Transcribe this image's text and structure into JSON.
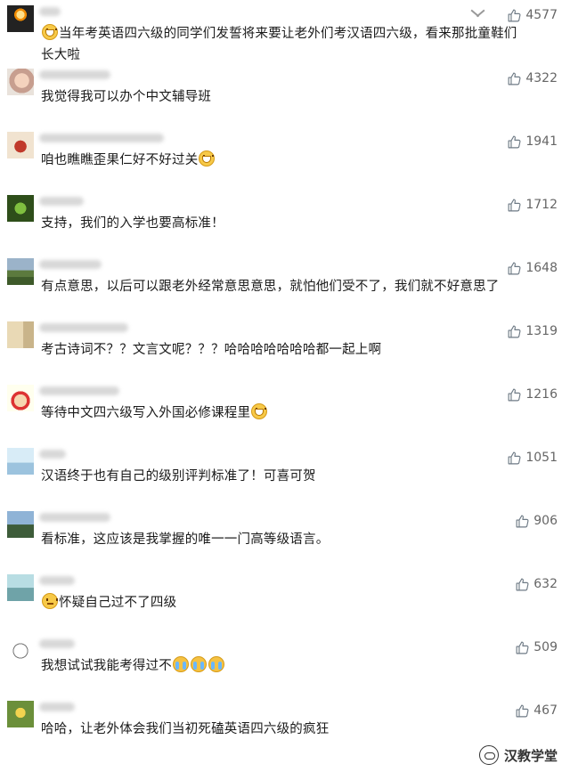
{
  "comments": [
    {
      "avatar": "candle-avatar",
      "likes": "4577",
      "pre_emoji": "grin",
      "text": "当年考英语四六级的同学们发誓将来要让老外们考汉语四六级，看来那批童鞋们",
      "text2": "长大啦",
      "post_emojis": []
    },
    {
      "avatar": "baby-avatar",
      "likes": "4322",
      "pre_emoji": null,
      "text": "我觉得我可以办个中文辅导班",
      "post_emojis": []
    },
    {
      "avatar": "vase-avatar",
      "likes": "1941",
      "pre_emoji": null,
      "text": "咱也瞧瞧歪果仁好不好过关",
      "post_emojis": [
        "grin"
      ]
    },
    {
      "avatar": "cartoon-avatar",
      "likes": "1712",
      "pre_emoji": null,
      "text": "支持，我们的入学也要高标准！",
      "post_emojis": []
    },
    {
      "avatar": "landscape-avatar",
      "likes": "1648",
      "pre_emoji": null,
      "text": "有点意思，以后可以跟老外经常意思意思，就怕他们受不了，我们就不好意思了",
      "post_emojis": []
    },
    {
      "avatar": "calligraphy-avatar",
      "likes": "1319",
      "pre_emoji": null,
      "text": "考古诗词不？？文言文呢？？？哈哈哈哈哈哈哈都一起上啊",
      "post_emojis": []
    },
    {
      "avatar": "santa-avatar",
      "likes": "1216",
      "pre_emoji": null,
      "text": "等待中文四六级写入外国必修课程里",
      "post_emojis": [
        "grin"
      ]
    },
    {
      "avatar": "bird-avatar",
      "likes": "1051",
      "pre_emoji": null,
      "text": "汉语终于也有自己的级别评判标准了！可喜可贺",
      "post_emojis": []
    },
    {
      "avatar": "city-avatar",
      "likes": "906",
      "pre_emoji": null,
      "text": "看标准，这应该是我掌握的唯一一门高等级语言。",
      "post_emojis": []
    },
    {
      "avatar": "figure-avatar",
      "likes": "632",
      "pre_emoji": "doubt",
      "text": "怀疑自己过不了四级",
      "post_emojis": []
    },
    {
      "avatar": "sketch-avatar",
      "likes": "509",
      "pre_emoji": null,
      "text": "我想试试我能考得过不",
      "post_emojis": [
        "cry",
        "cry",
        "cry"
      ]
    },
    {
      "avatar": "flower-avatar",
      "likes": "467",
      "pre_emoji": null,
      "text": "哈哈，让老外体会我们当初死磕英语四六级的疯狂",
      "post_emojis": []
    }
  ],
  "watermark": {
    "label": "汉教学堂",
    "icon": "wechat-logo-icon"
  },
  "colors": {
    "text": "#1a1a1a",
    "likes": "#666666",
    "background": "#ffffff"
  }
}
